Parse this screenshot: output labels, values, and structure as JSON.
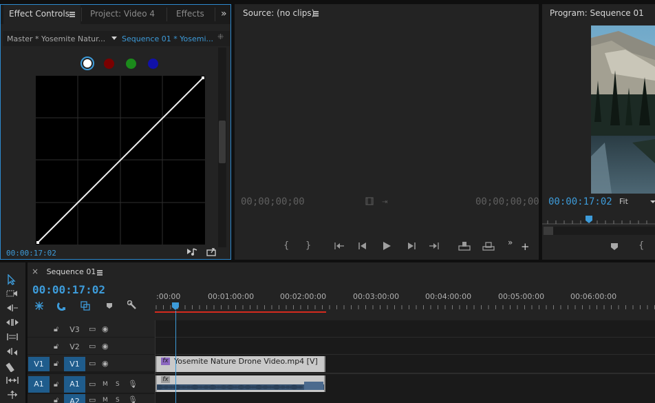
{
  "effect_controls": {
    "tabs": [
      {
        "label": "Effect Controls"
      },
      {
        "label": "Project: Video 4"
      },
      {
        "label": "Effects"
      }
    ],
    "overflow_label": "»",
    "master_label": "Master * Yosemite Natur...",
    "sequence_label": "Sequence 01 * Yosemi...",
    "channel_colors": [
      "#ffffff",
      "#8b0000",
      "#1f8a1f",
      "#1a1ab0"
    ],
    "timecode": "00:00:17:02"
  },
  "source": {
    "title": "Source: (no clips)",
    "timecode_left": "00;00;00;00",
    "timecode_right": "00;00;00;00",
    "overflow_label": "»"
  },
  "program": {
    "title": "Program: Sequence 01",
    "timecode": "00:00:17:02",
    "fit_label": "Fit"
  },
  "timeline": {
    "close_label": "×",
    "tab_label": "Sequence 01",
    "timecode": "00:00:17:02",
    "ruler_labels": [
      ":00:00",
      "00:01:00:00",
      "00:02:00:00",
      "00:03:00:00",
      "00:04:00:00",
      "00:05:00:00",
      "00:06:00:00"
    ],
    "tracks": {
      "v3": "V3",
      "v2": "V2",
      "v1_source": "V1",
      "v1": "V1",
      "a1_source": "A1",
      "a1": "A1",
      "a2": "A2",
      "m": "M",
      "s": "S"
    },
    "video_clip": "Yosemite Nature Drone Video.mp4 [V]",
    "fx_label": "fx"
  },
  "colors": {
    "accent_blue": "#3d9bd9",
    "render_bar_red": "#d62b1e",
    "clip_fill": "#c9c9c9"
  }
}
